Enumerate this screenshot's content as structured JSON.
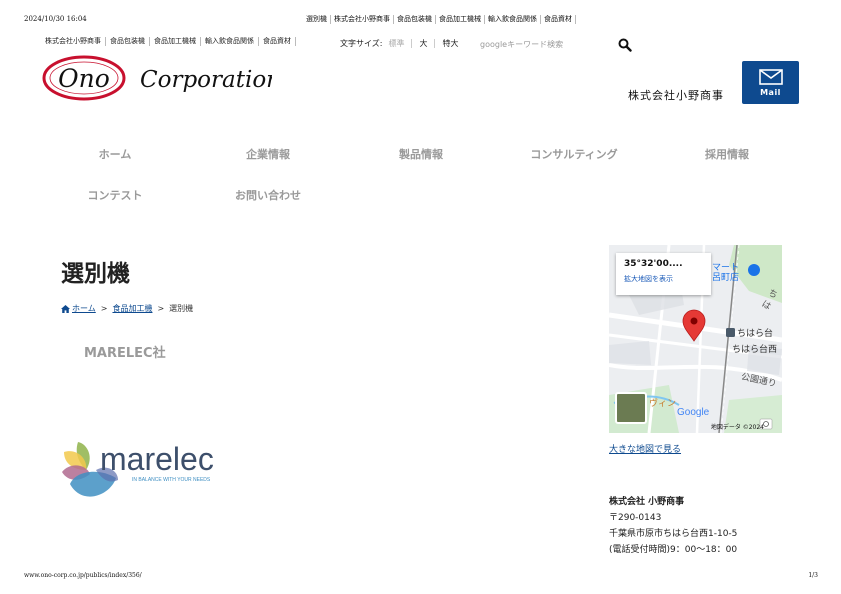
{
  "print": {
    "date": "2024/10/30 16:04",
    "title_parts": [
      "選別機",
      "株式会社小野商事",
      "食品包装機",
      "食品加工機械",
      "輸入飲食品関係",
      "食品資材"
    ],
    "url": "www.ono-corp.co.jp/publics/index/356/",
    "page": "1/3"
  },
  "top_links": [
    "株式会社小野商事",
    "食品包装機",
    "食品加工機械",
    "輸入飲食品関係",
    "食品資材"
  ],
  "font_size": {
    "label": "文字サイズ:",
    "options": [
      "標準",
      "大",
      "特大"
    ]
  },
  "search": {
    "placeholder": "googleキーワード検索"
  },
  "logo": {
    "ono": "Ono",
    "corporation": "Corporation"
  },
  "header": {
    "company_name": "株式会社小野商事",
    "mail_label": "Mail"
  },
  "nav": [
    "ホーム",
    "企業情報",
    "製品情報",
    "コンサルティング",
    "採用情報",
    "コンテスト",
    "お問い合わせ"
  ],
  "page": {
    "title": "選別機",
    "breadcrumb": [
      "ホーム",
      "食品加工機",
      "選別機"
    ],
    "maker": "MARELEC社"
  },
  "marelec": {
    "name": "marelec",
    "tagline": "IN BALANCE WITH YOUR NEEDS"
  },
  "map": {
    "coords": "35°32'00....",
    "enlarge": "拡大地図を表示",
    "labels": [
      "マート",
      "呂町店",
      "ちは",
      "ちはら台",
      "ちはら台西",
      "公園通り",
      "ヴィン",
      "Google"
    ],
    "attribution": "地図データ ©2024",
    "big_map_link": "大きな地図で見る"
  },
  "address": {
    "name": "株式会社 小野商事",
    "postal": "〒290-0143",
    "street": "千葉県市原市ちはら台西1-10-5",
    "hours": "(電話受付時間)9：00〜18：00"
  },
  "colors": {
    "accent": "#0e4a8f",
    "logo_red": "#c8102e",
    "nav_gray": "#9a9a9a"
  }
}
